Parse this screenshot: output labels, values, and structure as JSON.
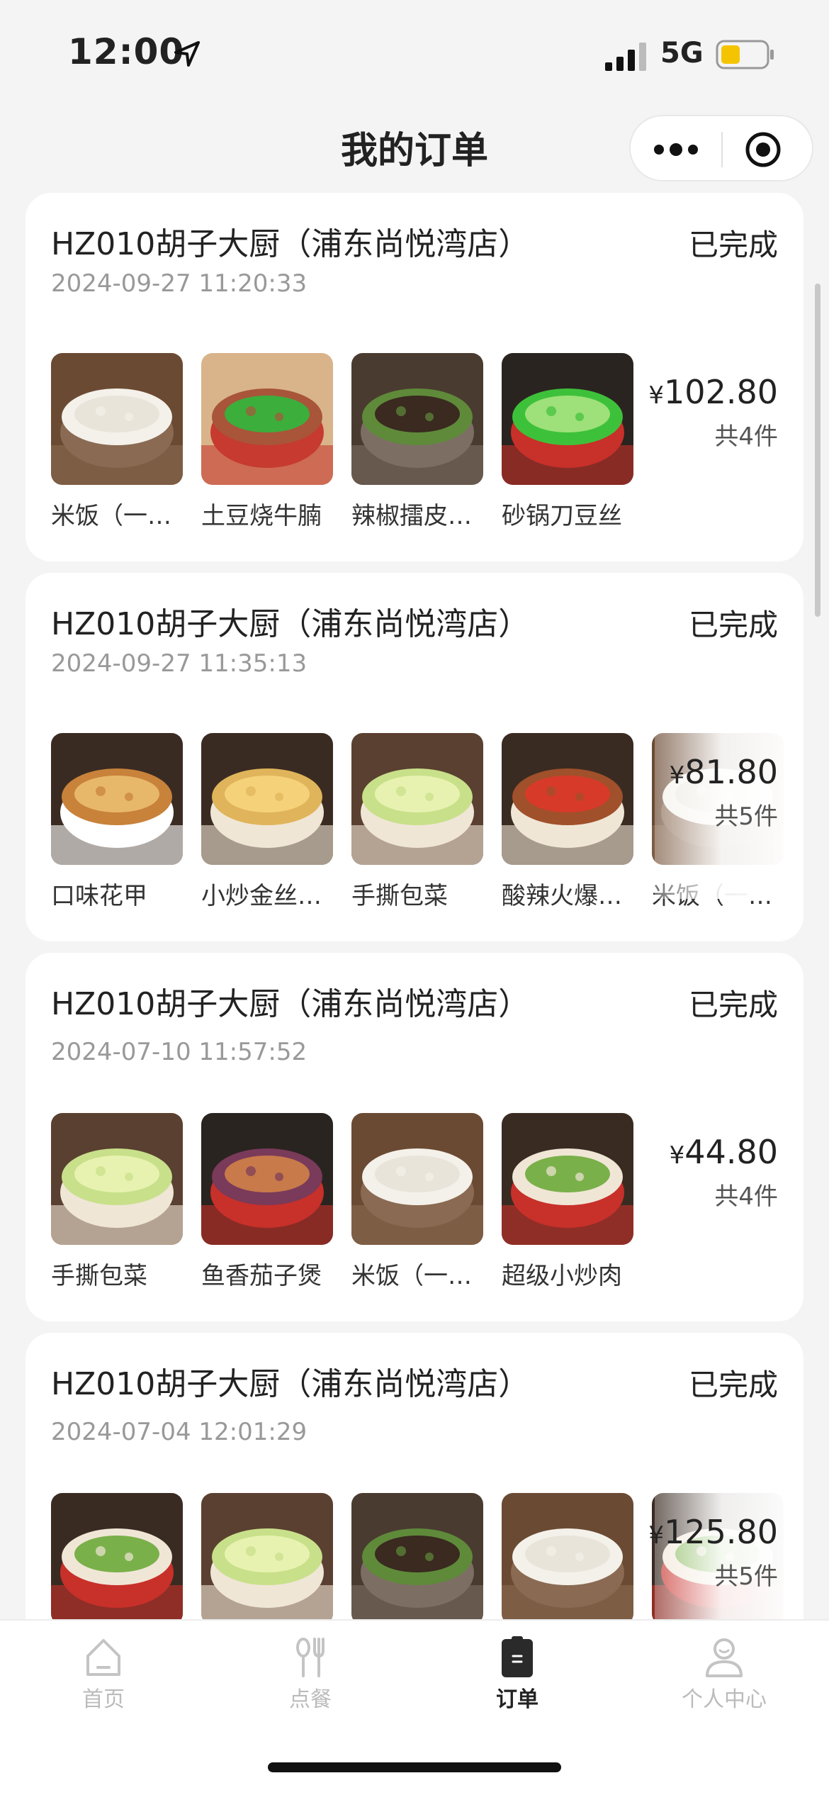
{
  "status_bar": {
    "time": "12:00",
    "network": "5G",
    "battery_color": "#f5c400"
  },
  "nav": {
    "title": "我的订单"
  },
  "orders": [
    {
      "store": "HZ010胡子大厨（浦东尚悦湾店）",
      "status": "已完成",
      "time": "2024-09-27  11:20:33",
      "price_symbol": "¥",
      "price": "102.80",
      "count": "共4件",
      "items": [
        {
          "name": "米饭（一…",
          "dish": "rice"
        },
        {
          "name": "土豆烧牛腩",
          "dish": "beef-potato"
        },
        {
          "name": "辣椒擂皮…",
          "dish": "pepper-mash"
        },
        {
          "name": "砂锅刀豆丝",
          "dish": "green-beans"
        }
      ]
    },
    {
      "store": "HZ010胡子大厨（浦东尚悦湾店）",
      "status": "已完成",
      "time": "2024-09-27  11:35:13",
      "price_symbol": "¥",
      "price": "81.80",
      "count": "共5件",
      "items": [
        {
          "name": "口味花甲",
          "dish": "clams"
        },
        {
          "name": "小炒金丝…",
          "dish": "golden-shreds"
        },
        {
          "name": "手撕包菜",
          "dish": "cabbage"
        },
        {
          "name": "酸辣火爆…",
          "dish": "spicy-stirfry"
        },
        {
          "name": "米饭（一…",
          "dish": "rice"
        }
      ]
    },
    {
      "store": "HZ010胡子大厨（浦东尚悦湾店）",
      "status": "已完成",
      "time": "2024-07-10 11:57:52",
      "price_symbol": "¥",
      "price": "44.80",
      "count": "共4件",
      "items": [
        {
          "name": "手撕包菜",
          "dish": "cabbage"
        },
        {
          "name": "鱼香茄子煲",
          "dish": "eggplant-pot"
        },
        {
          "name": "米饭（一…",
          "dish": "rice"
        },
        {
          "name": "超级小炒肉",
          "dish": "pork-pot"
        }
      ]
    },
    {
      "store": "HZ010胡子大厨（浦东尚悦湾店）",
      "status": "已完成",
      "time": "2024-07-04 12:01:29",
      "price_symbol": "¥",
      "price": "125.80",
      "count": "共5件",
      "items": [
        {
          "name": "",
          "dish": "pork-pot"
        },
        {
          "name": "",
          "dish": "cabbage"
        },
        {
          "name": "",
          "dish": "pepper-mash"
        },
        {
          "name": "",
          "dish": "rice"
        },
        {
          "name": "",
          "dish": "pork-pot"
        }
      ]
    }
  ],
  "tabs": [
    {
      "label": "首页",
      "icon": "home-icon",
      "active": false
    },
    {
      "label": "点餐",
      "icon": "utensils-icon",
      "active": false
    },
    {
      "label": "订单",
      "icon": "clipboard-icon",
      "active": true
    },
    {
      "label": "个人中心",
      "icon": "user-icon",
      "active": false
    }
  ]
}
